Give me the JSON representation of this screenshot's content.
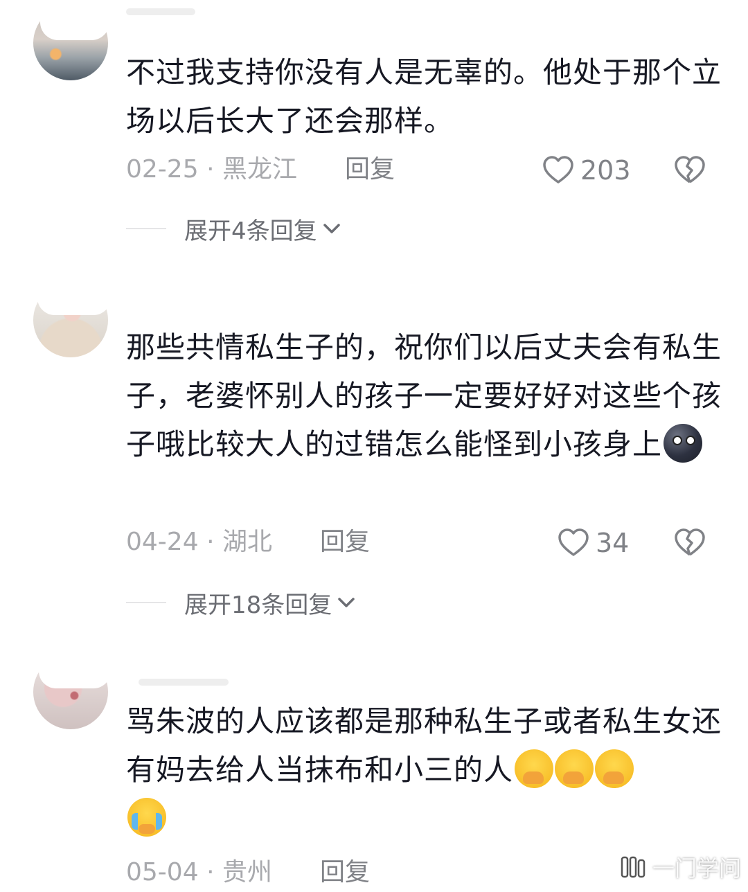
{
  "comments": [
    {
      "text": "不过我支持你没有人是无辜的。他处于那个立场以后长大了还会那样。",
      "date": "02-25",
      "location": "· 黑龙江",
      "reply_label": "回复",
      "likes": "203",
      "expand_label": "展开4条回复"
    },
    {
      "text": "那些共情私生子的，祝你们以后丈夫会有私生子，老婆怀别人的孩子一定要好好对这些个孩子哦比较大人的过错怎么能怪到小孩身上",
      "date": "04-24",
      "location": "· 湖北",
      "reply_label": "回复",
      "likes": "34",
      "expand_label": "展开18条回复"
    },
    {
      "text": "骂朱波的人应该都是那种私生子或者私生女还有妈去给人当抹布和小三的人",
      "date": "05-04",
      "location": "· 贵州",
      "reply_label": "回复"
    }
  ],
  "watermark": "一门学问",
  "icons": {
    "like": "heart-outline-icon",
    "dislike": "broken-heart-icon",
    "expand": "chevron-down-icon",
    "moon_emoji": "new-moon-face-emoji",
    "giggle_emoji": "face-with-hand-over-mouth-emoji",
    "tear_emoji": "face-holding-back-tears-emoji"
  },
  "colors": {
    "text": "#161823",
    "meta": "#a8a9ad",
    "action": "#808287",
    "expand": "#6b6d73"
  }
}
